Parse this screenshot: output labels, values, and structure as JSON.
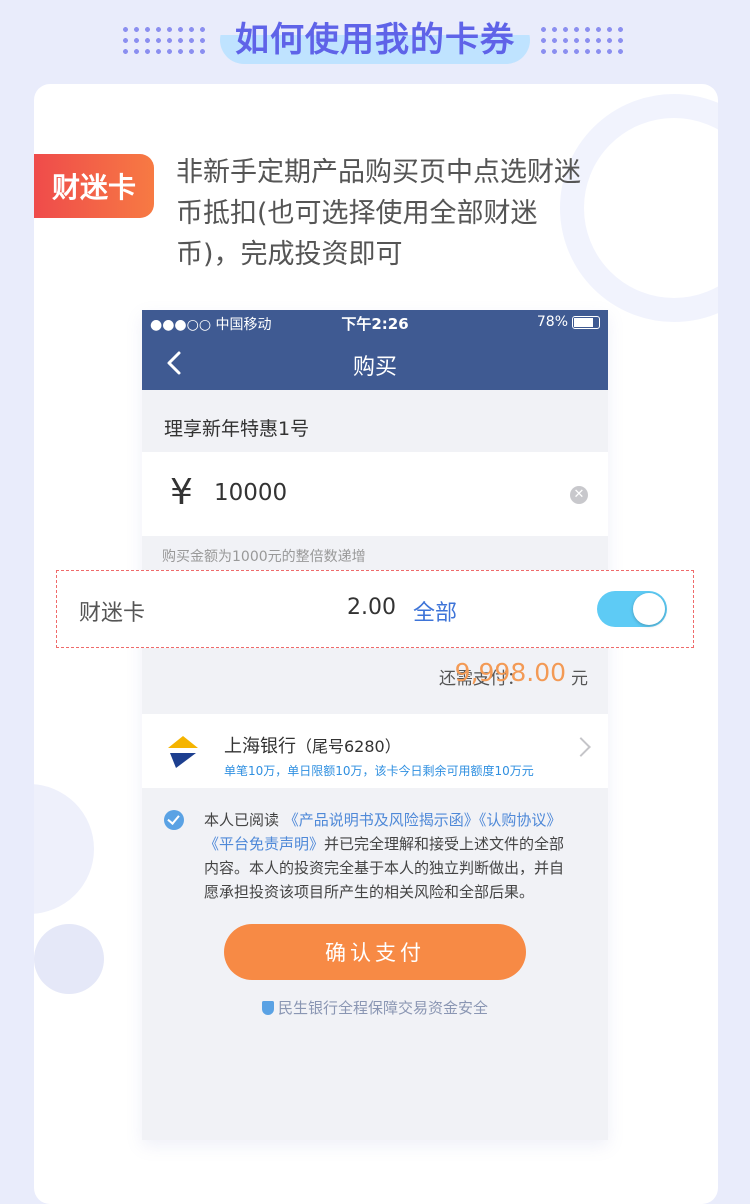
{
  "page": {
    "title": "如何使用我的卡券"
  },
  "intro": {
    "badge": "财迷卡",
    "description": "非新手定期产品购买页中点选财迷币抵扣(也可选择使用全部财迷币)，完成投资即可"
  },
  "phone": {
    "status": {
      "carrier": "●●●○○ 中国移动",
      "time": "下午2:26",
      "battery": "78%"
    },
    "nav": {
      "title": "购买"
    },
    "product_name": "理享新年特惠1号",
    "amount": {
      "currency": "¥",
      "value": "10000"
    },
    "hint": "购买金额为1000元的整倍数递增",
    "coin": {
      "label": "财迷卡",
      "value": "2.00",
      "all_label": "全部",
      "toggle_on": true
    },
    "payment": {
      "label": "还需支付：",
      "value": "9,998.00",
      "unit": "元"
    },
    "bank": {
      "name": "上海银行",
      "tail": "（尾号6280）",
      "limit": "单笔10万，单日限额10万，该卡今日剩余可用额度10万元"
    },
    "agreement": {
      "prefix": "本人已阅读",
      "doc1": "《产品说明书及风险揭示函》",
      "doc2": "《认购协议》",
      "doc3": "《平台免责声明》",
      "suffix": "并已完全理解和接受上述文件的全部内容。本人的投资完全基于本人的独立判断做出，并自愿承担投资该项目所产生的相关风险和全部后果。"
    },
    "confirm": "确认支付",
    "safety": "民生银行全程保障交易资金安全"
  },
  "colors": {
    "accent": "#5f63e8",
    "nav": "#3f5a92",
    "orange": "#f78a45",
    "badge": "#ef4b4b",
    "toggle": "#5ecbf5"
  }
}
